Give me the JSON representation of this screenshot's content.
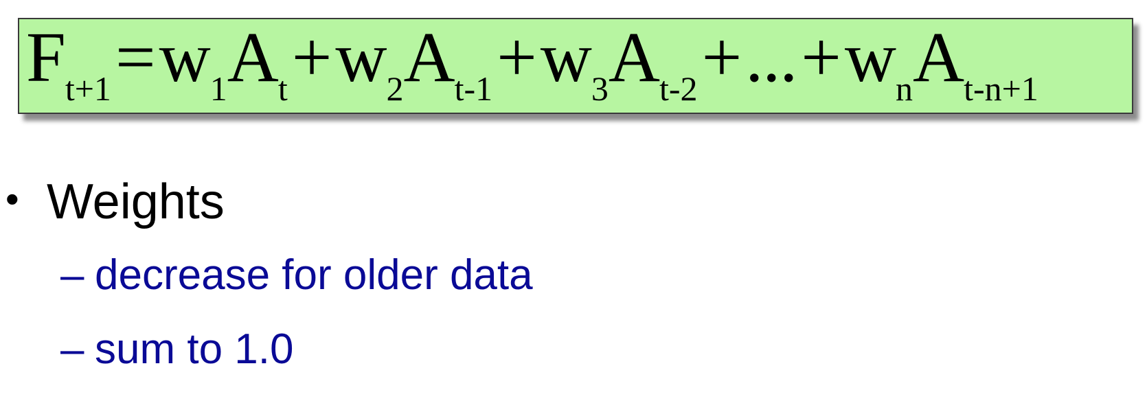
{
  "formula": {
    "F": "F",
    "F_sub": "t+1",
    "eq": "=",
    "w1": "w",
    "w1_sub": "1",
    "A1": "A",
    "A1_sub": "t",
    "plus1": "+",
    "w2": "w",
    "w2_sub": "2",
    "A2": "A",
    "A2_sub": "t-1",
    "plus2": "+",
    "w3": "w",
    "w3_sub": "3",
    "A3": "A",
    "A3_sub": "t-2",
    "plus3": "+",
    "ellipsis": "...",
    "plus4": "+",
    "wn": "w",
    "wn_sub": "n",
    "An": "A",
    "An_sub": "t-n+1"
  },
  "bullets": {
    "dot": "•",
    "main": "Weights",
    "dash": "–",
    "items": [
      "decrease for older data",
      "sum to 1.0"
    ]
  },
  "colors": {
    "formula_background": "#b7f5a1",
    "sub_bullet_text": "#0a0a96"
  }
}
